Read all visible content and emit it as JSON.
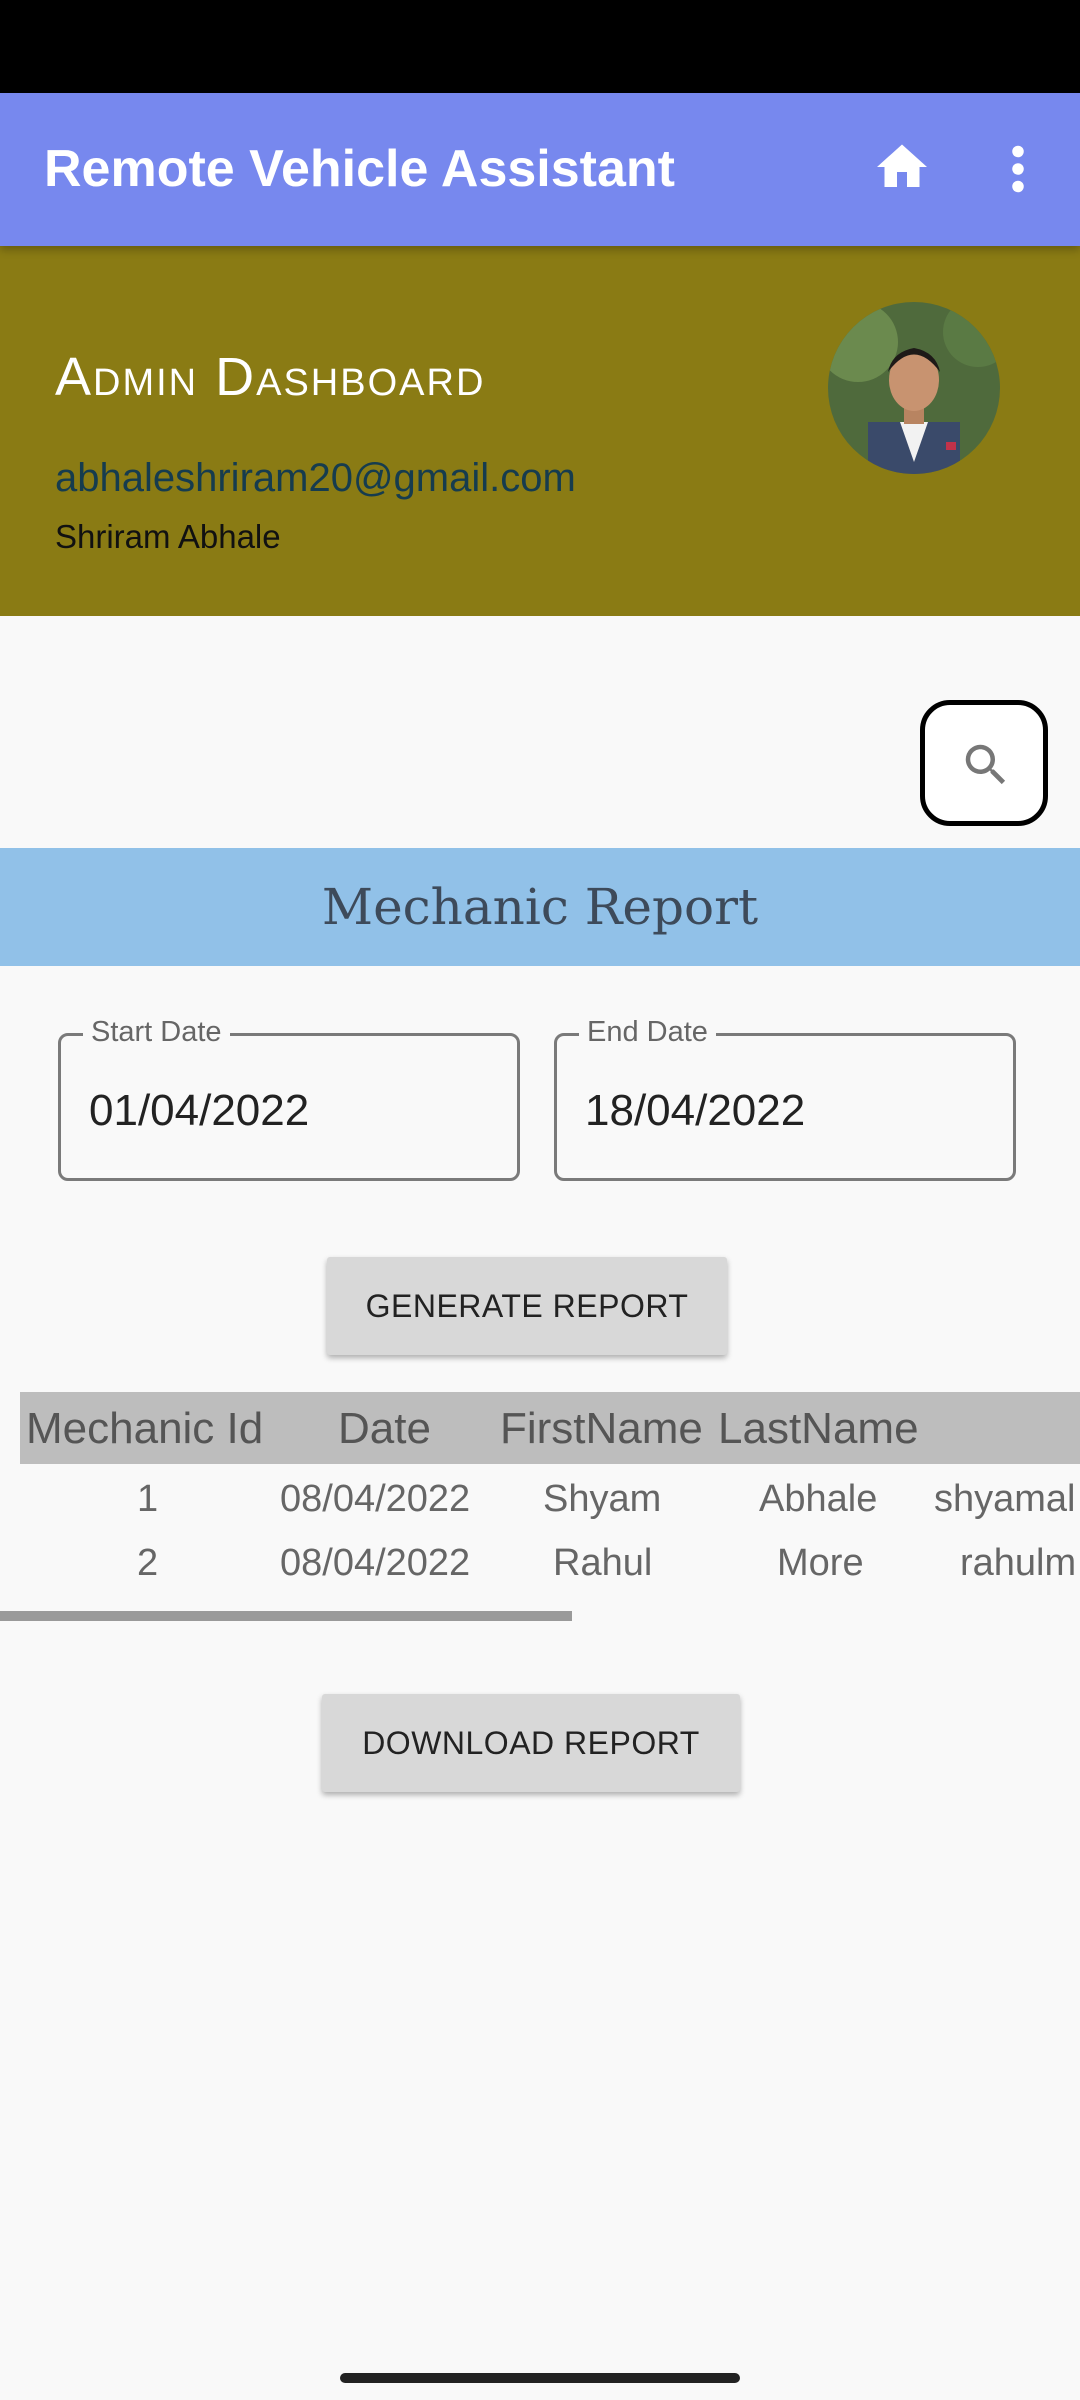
{
  "app_bar": {
    "title": "Remote Vehicle Assistant",
    "home_icon": "home-icon",
    "more_icon": "more-vert-icon",
    "color": "#7788ee"
  },
  "header": {
    "title": "Admin Dashboard",
    "email": "abhaleshriram20@gmail.com",
    "name": "Shriram Abhale",
    "color": "#8a7b14"
  },
  "search": {
    "icon": "search-icon"
  },
  "report": {
    "title": "Mechanic Report",
    "banner_color": "#91c1e8"
  },
  "start_date": {
    "label": "Start Date",
    "value": "01/04/2022"
  },
  "end_date": {
    "label": "End Date",
    "value": "18/04/2022"
  },
  "buttons": {
    "generate": "GENERATE REPORT",
    "download": "DOWNLOAD REPORT"
  },
  "table": {
    "headers": [
      "Mechanic Id",
      "Date",
      "FirstName",
      "LastName"
    ],
    "rows": [
      [
        "1",
        "08/04/2022",
        "Shyam",
        "Abhale",
        "shyamal"
      ],
      [
        "2",
        "08/04/2022",
        "Rahul",
        "More",
        "rahulm"
      ]
    ]
  }
}
